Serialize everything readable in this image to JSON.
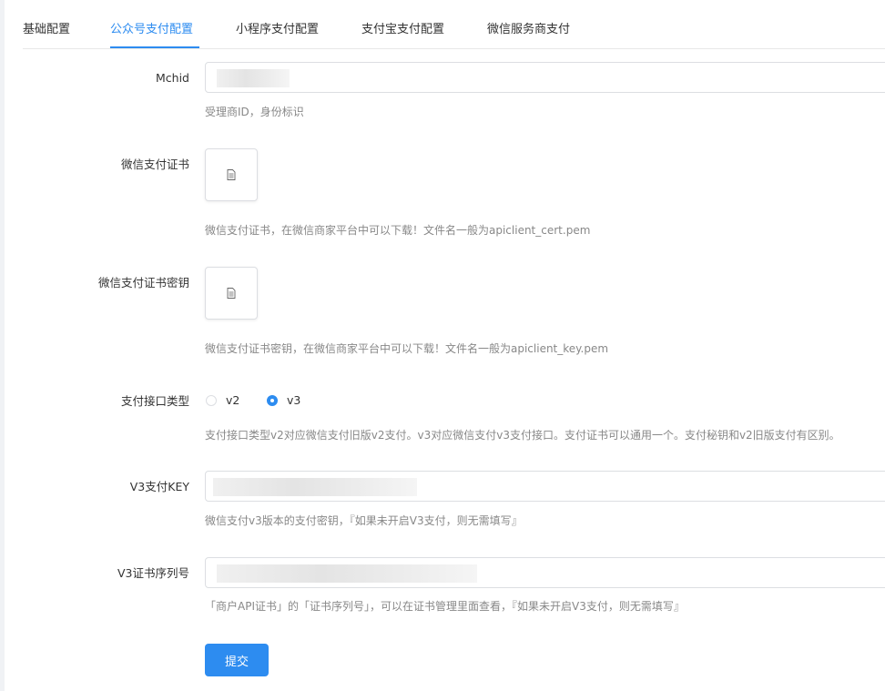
{
  "tabs": [
    {
      "label": "基础配置",
      "active": false
    },
    {
      "label": "公众号支付配置",
      "active": true
    },
    {
      "label": "小程序支付配置",
      "active": false
    },
    {
      "label": "支付宝支付配置",
      "active": false
    },
    {
      "label": "微信服务商支付",
      "active": false
    }
  ],
  "form": {
    "mchid": {
      "label": "Mchid",
      "help": "受理商ID，身份标识"
    },
    "cert": {
      "label": "微信支付证书",
      "help": "微信支付证书，在微信商家平台中可以下载！文件名一般为apiclient_cert.pem"
    },
    "cert_key": {
      "label": "微信支付证书密钥",
      "help": "微信支付证书密钥，在微信商家平台中可以下载！文件名一般为apiclient_key.pem"
    },
    "api_type": {
      "label": "支付接口类型",
      "options": [
        "v2",
        "v3"
      ],
      "selected": "v3",
      "help": "支付接口类型v2对应微信支付旧版v2支付。v3对应微信支付v3支付接口。支付证书可以通用一个。支付秘钥和v2旧版支付有区别。"
    },
    "v3_key": {
      "label": "V3支付KEY",
      "help": "微信支付v3版本的支付密钥，『如果未开启V3支付，则无需填写』"
    },
    "v3_serial": {
      "label": "V3证书序列号",
      "help": "「商户API证书」的「证书序列号」，可以在证书管理里面查看，『如果未开启V3支付，则无需填写』"
    }
  },
  "submit_label": "提交",
  "colors": {
    "accent": "#2d8cf0",
    "border": "#dcdee2",
    "help_text": "#888888"
  }
}
